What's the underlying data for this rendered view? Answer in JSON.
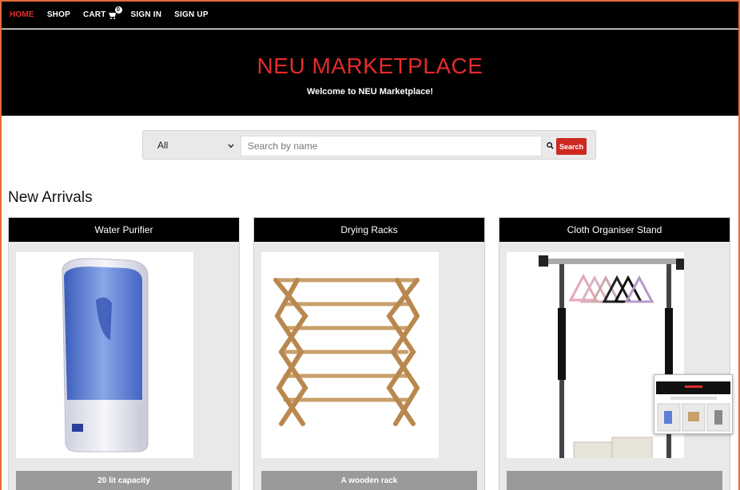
{
  "nav": {
    "items": [
      {
        "label": "HOME",
        "active": true
      },
      {
        "label": "SHOP"
      },
      {
        "label": "CART"
      },
      {
        "label": "SIGN IN"
      },
      {
        "label": "SIGN UP"
      }
    ],
    "cart_count": "0"
  },
  "hero": {
    "title": "NEU MARKETPLACE",
    "subtitle": "Welcome to NEU Marketplace!"
  },
  "search": {
    "category": "All",
    "placeholder": "Search by name",
    "button_label": "Search"
  },
  "section_title": "New Arrivals",
  "products": [
    {
      "name": "Water Purifier",
      "caption": "20 lit capacity"
    },
    {
      "name": "Drying Racks",
      "caption": "A wooden rack"
    },
    {
      "name": "Cloth Organiser Stand",
      "caption": ""
    }
  ],
  "colors": {
    "accent": "#e52b2b",
    "nav_bg": "#000000",
    "button": "#cc2a20",
    "frame": "#e46a3c"
  }
}
